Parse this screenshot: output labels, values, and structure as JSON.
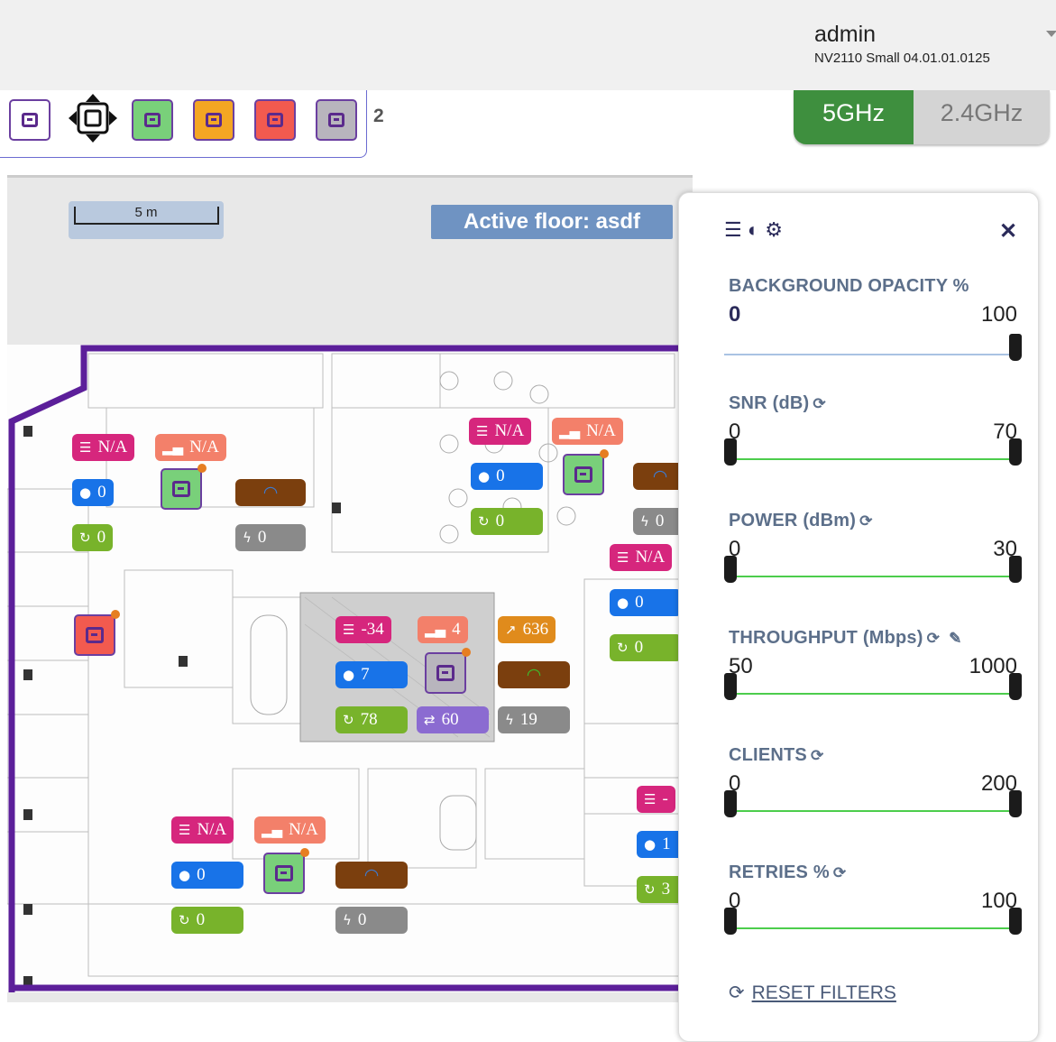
{
  "header": {
    "user": "admin",
    "version": "NV2110 Small 04.01.01.0125"
  },
  "toolbar": {
    "swatch_colors": [
      "#ffffff",
      "#79d07a",
      "#f4a623",
      "#f25a4f",
      "#b8b5bd"
    ],
    "count": "2",
    "bands": {
      "five": "5GHz",
      "two_four": "2.4GHz",
      "active": "5GHz"
    }
  },
  "map": {
    "scale_label": "5 m",
    "active_floor": "Active floor: asdf"
  },
  "aps": [
    {
      "snr": "N/A",
      "power": "N/A",
      "clients": "0",
      "retries": "0",
      "radio": "0",
      "color": "#79d07a"
    },
    {
      "snr": "N/A",
      "power": "N/A",
      "clients": "0",
      "retries": "0",
      "color": "#79d07a"
    },
    {
      "snr": "-34",
      "power": "4",
      "throughput": "636",
      "clients": "7",
      "retries": "78",
      "channel": "60",
      "radio": "19",
      "color": "#b8b5bd"
    },
    {
      "snr": "N/A",
      "power": "N/A",
      "clients": "0",
      "retries": "0",
      "radio": "0",
      "color": "#79d07a"
    },
    {
      "color": "#f25a4f"
    },
    {
      "snr": "N/A",
      "clients": "0",
      "retries": "0",
      "radio": "0"
    },
    {
      "snr": "-",
      "clients": "1",
      "retries": "3"
    }
  ],
  "panel": {
    "icons": [
      "list-icon",
      "contrast-icon",
      "gear-icon"
    ],
    "filters": [
      {
        "title": "BACKGROUND OPACITY %",
        "min": "0",
        "max": "100",
        "handles": [
          1.0
        ]
      },
      {
        "title": "SNR (dB)",
        "min": "0",
        "max": "70",
        "handles": [
          0.0,
          1.0
        ]
      },
      {
        "title": "POWER (dBm)",
        "min": "0",
        "max": "30",
        "handles": [
          0.0,
          1.0
        ]
      },
      {
        "title": "THROUGHPUT (Mbps)",
        "min": "50",
        "max": "1000",
        "handles": [
          0.0,
          1.0
        ]
      },
      {
        "title": "CLIENTS",
        "min": "0",
        "max": "200",
        "handles": [
          0.0,
          1.0
        ]
      },
      {
        "title": "RETRIES %",
        "min": "0",
        "max": "100",
        "handles": [
          0.0,
          1.0
        ]
      }
    ],
    "reset_label": "RESET FILTERS"
  }
}
